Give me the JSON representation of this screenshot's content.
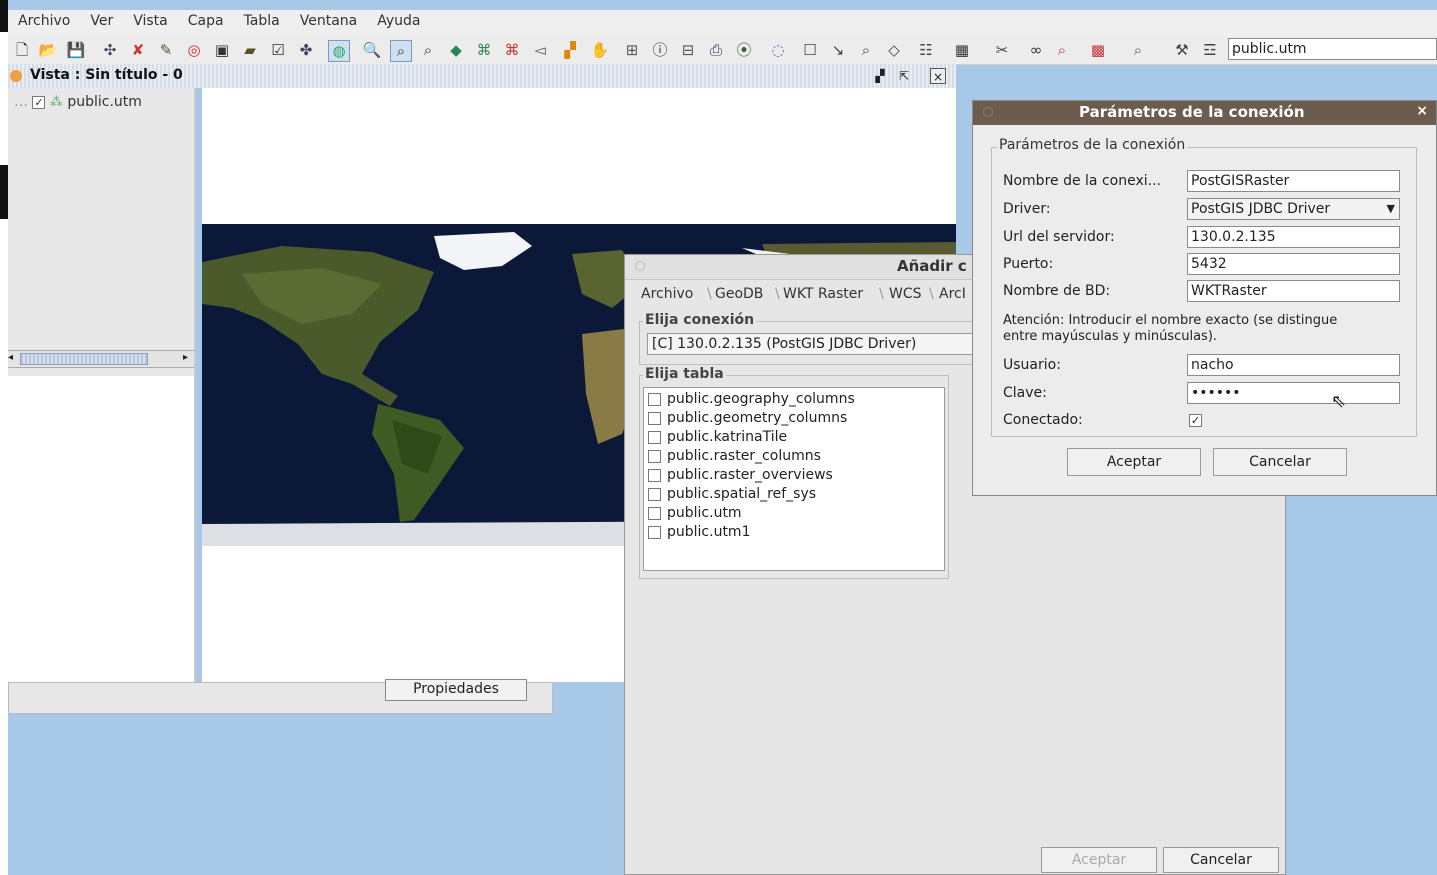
{
  "menubar": {
    "items": [
      "Archivo",
      "Ver",
      "Vista",
      "Capa",
      "Tabla",
      "Ventana",
      "Ayuda"
    ]
  },
  "toolbar": {
    "layer_selector_value": "public.utm"
  },
  "view_window": {
    "title": "Vista : Sin título - 0",
    "toc_layer": "public.utm",
    "properties_button": "Propiedades"
  },
  "add_layer_dialog": {
    "title": "Añadir c",
    "tabs": [
      "Archivo",
      "GeoDB",
      "WKT Raster",
      "WCS",
      "ArcI"
    ],
    "connection_group": "Elija conexión",
    "connection_value": "[C] 130.0.2.135 (PostGIS JDBC Driver)",
    "table_group": "Elija tabla",
    "tables": [
      "public.geography_columns",
      "public.geometry_columns",
      "public.katrinaTile",
      "public.raster_columns",
      "public.raster_overviews",
      "public.spatial_ref_sys",
      "public.utm",
      "public.utm1"
    ],
    "accept_label": "Aceptar",
    "cancel_label": "Cancelar"
  },
  "connection_dialog": {
    "title": "Parámetros de la conexión",
    "close_glyph": "×",
    "group_title": "Parámetros de la conexión",
    "fields": {
      "name_label": "Nombre de la conexi...",
      "name_value": "PostGISRaster",
      "driver_label": "Driver:",
      "driver_value": "PostGIS JDBC Driver",
      "server_label": "Url del servidor:",
      "server_value": "130.0.2.135",
      "port_label": "Puerto:",
      "port_value": "5432",
      "db_label": "Nombre de BD:",
      "db_value": "WKTRaster",
      "note": "Atención: Introducir el nombre exacto (se distingue entre mayúsculas y minúsculas).",
      "user_label": "Usuario:",
      "user_value": "nacho",
      "password_label": "Clave:",
      "password_value": "••••••",
      "connected_label": "Conectado:"
    },
    "accept_label": "Aceptar",
    "cancel_label": "Cancelar"
  },
  "colors": {
    "desktop": "#a8c8e8",
    "conn_title_bar": "#6b5c4e",
    "map_ocean": "#0d1a3c"
  }
}
